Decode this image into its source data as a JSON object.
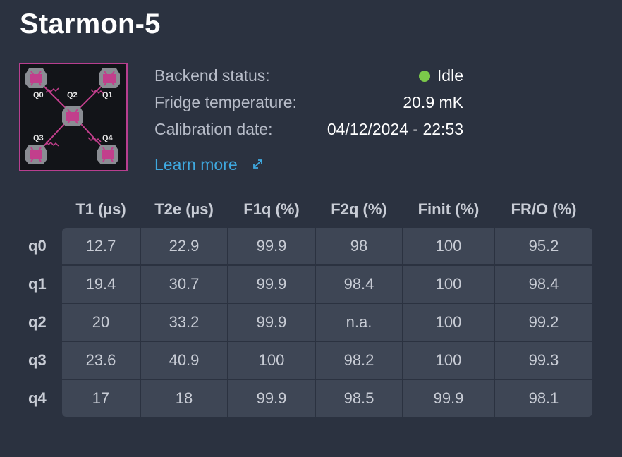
{
  "title": "Starmon-5",
  "chip": {
    "qubit_labels": [
      "Q0",
      "Q2",
      "Q1",
      "Q3",
      "Q4"
    ],
    "accent_color": "#d0418f"
  },
  "info": {
    "backend_status_label": "Backend status:",
    "backend_status_value": "Idle",
    "status_color": "#7bc94a",
    "fridge_label": "Fridge temperature:",
    "fridge_value": "20.9 mK",
    "calibration_label": "Calibration date:",
    "calibration_value": "04/12/2024 - 22:53"
  },
  "learn_more": {
    "label": "Learn more",
    "icon": "external-link-icon"
  },
  "table": {
    "columns": [
      "T1 (µs)",
      "T2e (µs)",
      "F1q (%)",
      "F2q (%)",
      "Finit (%)",
      "FR/O (%)"
    ],
    "rows": [
      {
        "label": "q0",
        "cells": [
          "12.7",
          "22.9",
          "99.9",
          "98",
          "100",
          "95.2"
        ]
      },
      {
        "label": "q1",
        "cells": [
          "19.4",
          "30.7",
          "99.9",
          "98.4",
          "100",
          "98.4"
        ]
      },
      {
        "label": "q2",
        "cells": [
          "20",
          "33.2",
          "99.9",
          "n.a.",
          "100",
          "99.2"
        ]
      },
      {
        "label": "q3",
        "cells": [
          "23.6",
          "40.9",
          "100",
          "98.2",
          "100",
          "99.3"
        ]
      },
      {
        "label": "q4",
        "cells": [
          "17",
          "18",
          "99.9",
          "98.5",
          "99.9",
          "98.1"
        ]
      }
    ]
  }
}
